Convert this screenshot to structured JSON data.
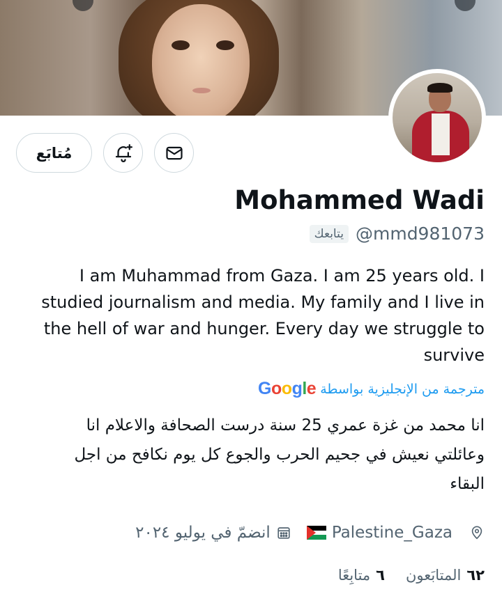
{
  "profile": {
    "display_name": "Mohammed Wadi",
    "handle": "@mmd981073",
    "follows_you_badge": "يتابعك",
    "bio_translated": "I am Muhammad from Gaza. I am 25 years old. I studied journalism and media. My family and I live in the hell of war and hunger. Every day we struggle to survive",
    "translation_label": "مترجمة من الإنجليزية بواسطة",
    "translation_provider": "Google",
    "bio_original": "انا محمد من غزة عمري 25 سنة درست الصحافة والاعلام انا وعائلتي نعيش في جحيم الحرب والجوع كل يوم نكافح من اجل البقاء",
    "location": "Palestine_Gaza",
    "joined": "انضمّ في يوليو ٢٠٢٤",
    "following": {
      "count": "٦",
      "label": "متابِعًا"
    },
    "followers": {
      "count": "٦٢",
      "label": "المتابَعون"
    }
  },
  "actions": {
    "follow_label": "مُتابَع",
    "message_icon": "mail-icon",
    "notify_icon": "bell-plus-icon"
  },
  "colors": {
    "link_blue": "#1d9bf0",
    "secondary_text": "#536471",
    "border": "#cfd9de"
  }
}
